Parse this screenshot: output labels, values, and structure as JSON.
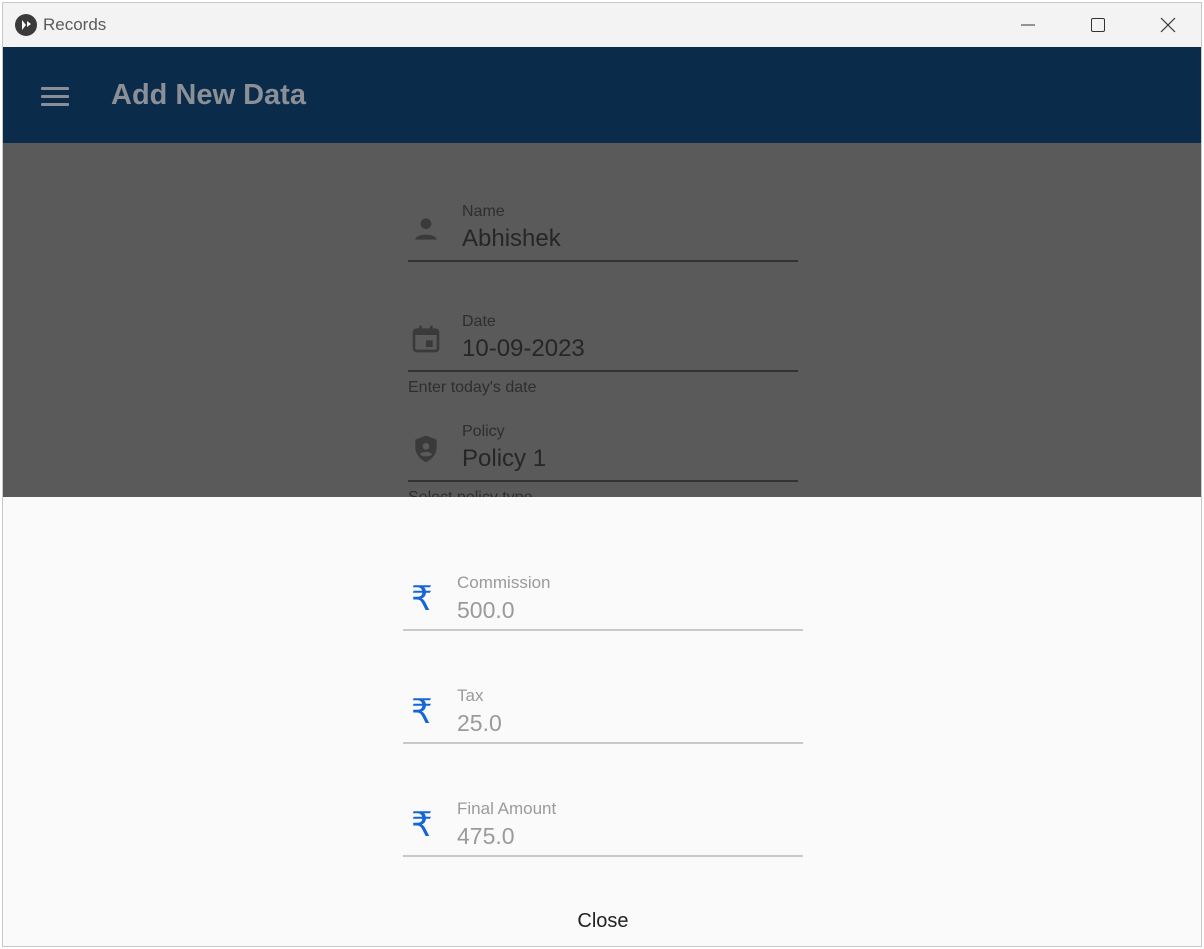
{
  "window": {
    "title": "Records",
    "icons": {
      "app": "kivy-app-icon",
      "minimize": "minimize-icon",
      "maximize": "maximize-icon",
      "close": "close-icon"
    }
  },
  "appbar": {
    "title": "Add New Data",
    "menu_icon": "menu-icon",
    "background": "#0a2b4a"
  },
  "form": {
    "name": {
      "label": "Name",
      "value": "Abhishek",
      "icon": "person-icon"
    },
    "date": {
      "label": "Date",
      "value": "10-09-2023",
      "helper": "Enter today's date",
      "icon": "calendar-icon"
    },
    "policy": {
      "label": "Policy",
      "value": "Policy 1",
      "helper": "Select policy type",
      "icon": "shield-icon"
    }
  },
  "dialog": {
    "fields": [
      {
        "label": "Commission",
        "value": "500.0",
        "icon": "₹"
      },
      {
        "label": "Tax",
        "value": "25.0",
        "icon": "₹"
      },
      {
        "label": "Final Amount",
        "value": "475.0",
        "icon": "₹"
      }
    ],
    "close_label": "Close",
    "accent": "#1565d8"
  }
}
